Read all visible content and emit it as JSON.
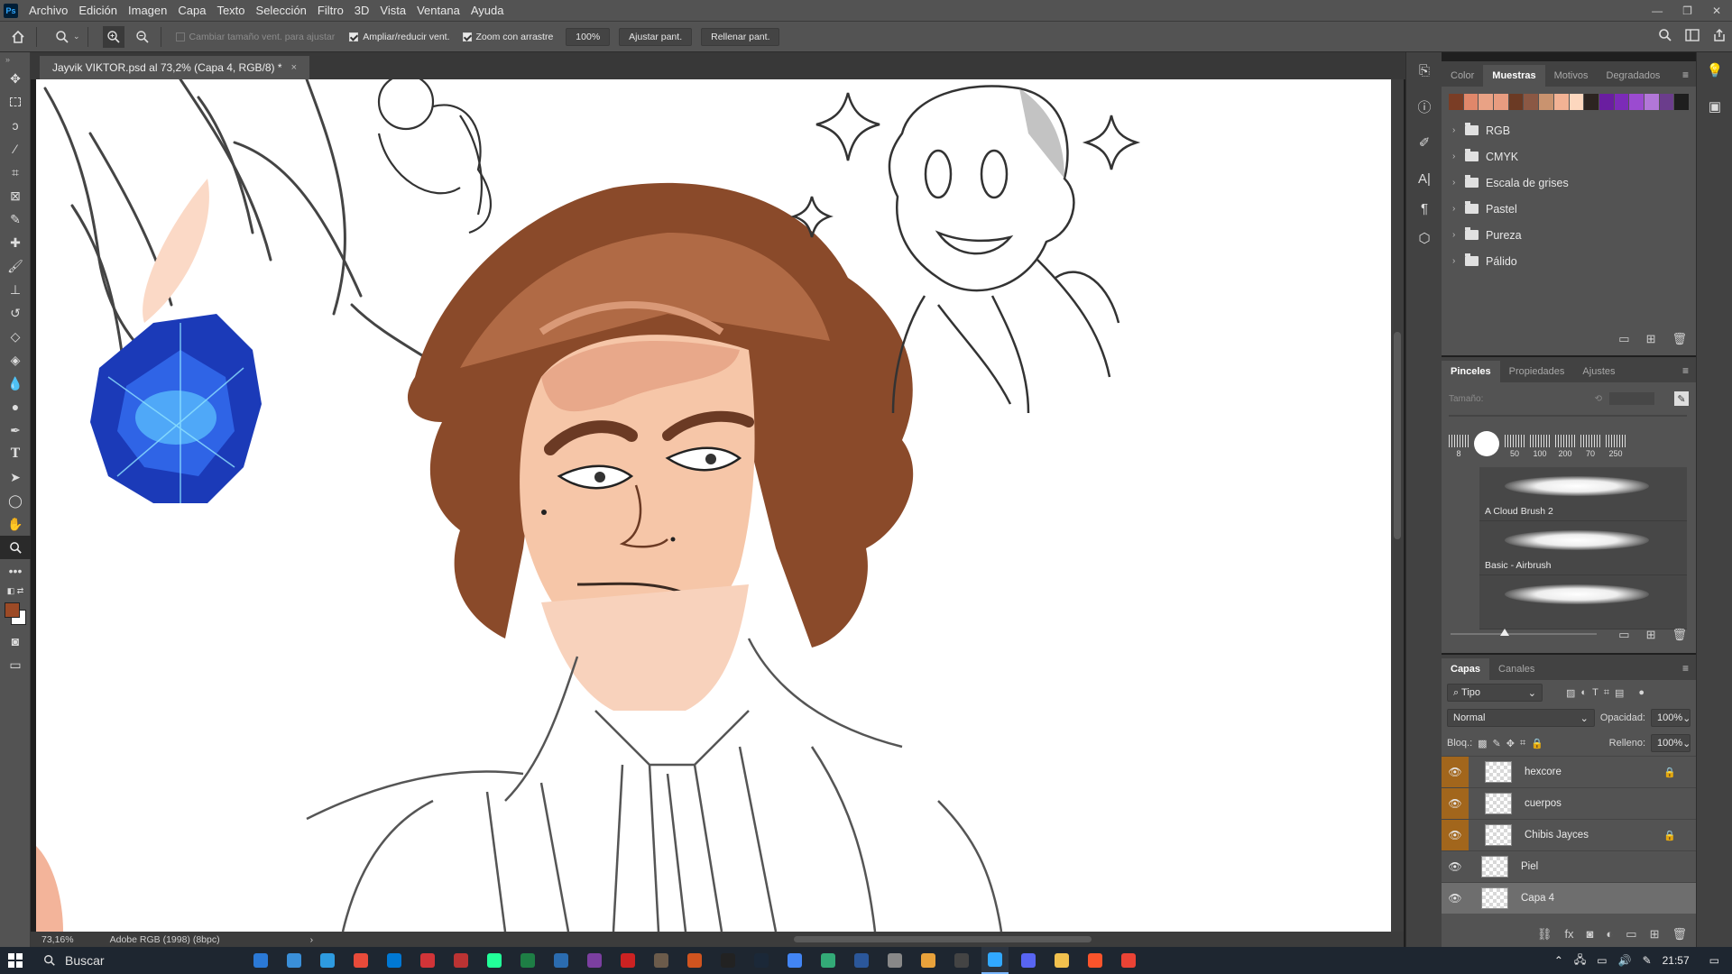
{
  "app": {
    "logo": "Ps"
  },
  "menu": [
    "Archivo",
    "Edición",
    "Imagen",
    "Capa",
    "Texto",
    "Selección",
    "Filtro",
    "3D",
    "Vista",
    "Ventana",
    "Ayuda"
  ],
  "options": {
    "resize_windows": "Cambiar tamaño vent. para ajustar",
    "zoom_all": "Ampliar/reducir vent.",
    "scrubby_zoom": "Zoom con arrastre",
    "zoom_value": "100%",
    "fit_screen": "Ajustar pant.",
    "fill_screen": "Rellenar pant."
  },
  "document": {
    "tab_title": "Jayvik VIKTOR.psd al 73,2% (Capa 4, RGB/8) *",
    "close": "×"
  },
  "status": {
    "zoom": "73,16%",
    "profile": "Adobe RGB (1998) (8bpc)",
    "arrow": "›"
  },
  "swatches_panel": {
    "tabs": [
      "Color",
      "Muestras",
      "Motivos",
      "Degradados"
    ],
    "active_tab": "Muestras",
    "colors": [
      "#7a3d25",
      "#e0876a",
      "#e9a285",
      "#e89c80",
      "#6b3a24",
      "#8b5844",
      "#c9936f",
      "#f2b294",
      "#fdd7be",
      "#2c2420",
      "#6a1ea0",
      "#7c2bb8",
      "#9b4bd0",
      "#b277d8",
      "#6b3d8c",
      "#1e1e1e"
    ],
    "folders": [
      "RGB",
      "CMYK",
      "Escala de grises",
      "Pastel",
      "Pureza",
      "Pálido"
    ]
  },
  "brushes_panel": {
    "tabs": [
      "Pinceles",
      "Propiedades",
      "Ajustes"
    ],
    "active_tab": "Pinceles",
    "size_label": "Tamaño:",
    "presets": [
      "8",
      "",
      "50",
      "100",
      "200",
      "70",
      "250"
    ],
    "items": [
      "A Cloud Brush 2",
      "Basic - Airbrush",
      ""
    ]
  },
  "layers_panel": {
    "tabs": [
      "Capas",
      "Canales"
    ],
    "active_tab": "Capas",
    "filter": "Tipo",
    "blend_mode": "Normal",
    "opacity_label": "Opacidad:",
    "opacity": "100%",
    "lock_label": "Bloq.:",
    "fill_label": "Relleno:",
    "fill": "100%",
    "layers": [
      {
        "name": "hexcore",
        "locked": true,
        "grouped": true,
        "selected": false
      },
      {
        "name": "cuerpos",
        "locked": false,
        "grouped": true,
        "selected": false
      },
      {
        "name": "Chibis Jayces",
        "locked": true,
        "grouped": true,
        "selected": false
      },
      {
        "name": "Piel",
        "locked": false,
        "grouped": false,
        "selected": false
      },
      {
        "name": "Capa 4",
        "locked": false,
        "grouped": false,
        "selected": true
      }
    ]
  },
  "taskbar": {
    "search": "Buscar",
    "time": "21:57",
    "apps": [
      "#2b79d6",
      "#3a8fd8",
      "#2e9be0",
      "#e84b3a",
      "#0078d4",
      "#d13438",
      "#b33",
      "#2f9",
      "#1e7e45",
      "#2b6cb0",
      "#7b3fa0",
      "#c22",
      "#6b5b4b",
      "#d0541f",
      "#222",
      "#1b2838",
      "#4285f4",
      "#3a7",
      "#2b579a",
      "#888",
      "#e9a23b",
      "#444",
      "#31a8ff",
      "#5865f2",
      "#f2c14e",
      "#fb542b",
      "#ea4335"
    ]
  }
}
